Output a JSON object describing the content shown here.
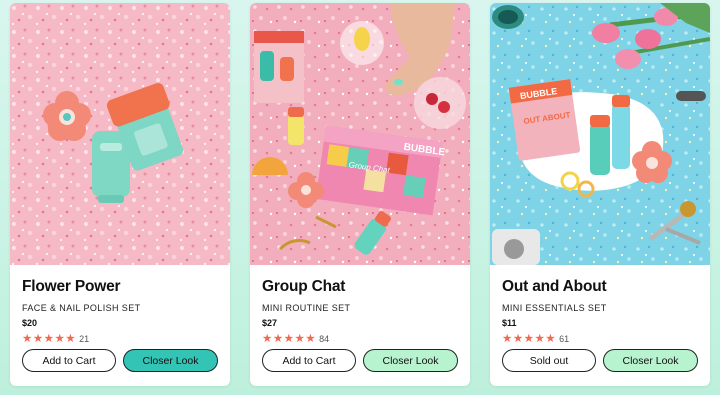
{
  "products": [
    {
      "title": "Flower Power",
      "subtitle": "FACE & NAIL POLISH SET",
      "price": "$20",
      "rating_stars": 5,
      "review_count": "21",
      "left_button": "Add to Cart",
      "right_button": "Closer Look"
    },
    {
      "title": "Group Chat",
      "subtitle": "MINI ROUTINE SET",
      "price": "$27",
      "rating_stars": 5,
      "review_count": "84",
      "left_button": "Add to Cart",
      "right_button": "Closer Look"
    },
    {
      "title": "Out and About",
      "subtitle": "MINI ESSENTIALS SET",
      "price": "$11",
      "rating_stars": 5,
      "review_count": "61",
      "left_button": "Sold out",
      "right_button": "Closer Look"
    }
  ],
  "brand_print": {
    "box_text": "BUBBLE",
    "kit_text": "Group Chat",
    "out_text": "OUT ABOUT"
  },
  "colors": {
    "closer_look_primary": "#33c4b5",
    "closer_look_secondary": "#b7f3cf",
    "star": "#f06a50"
  }
}
